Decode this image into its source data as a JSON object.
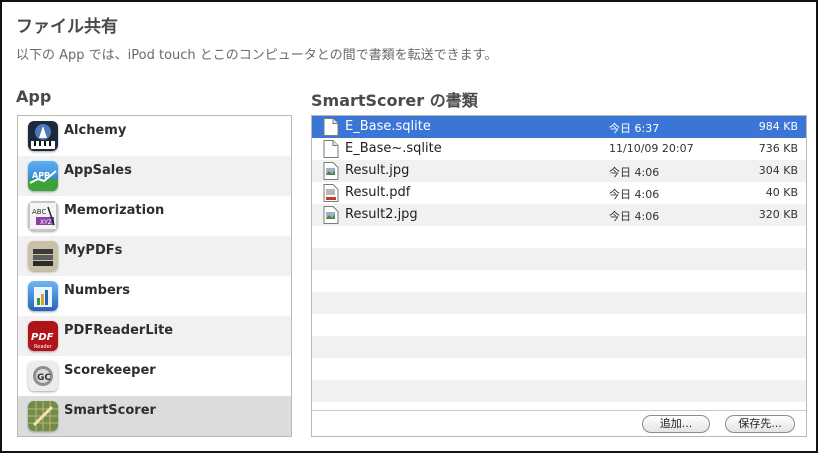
{
  "header": {
    "title": "ファイル共有",
    "subtitle": "以下の App では、iPod touch とこのコンピュータとの間で書類を転送できます。"
  },
  "apps": {
    "heading": "App",
    "items": [
      {
        "name": "Alchemy",
        "icon": "alchemy-icon"
      },
      {
        "name": "AppSales",
        "icon": "appsales-icon"
      },
      {
        "name": "Memorization",
        "icon": "memorization-icon"
      },
      {
        "name": "MyPDFs",
        "icon": "mypdfs-icon"
      },
      {
        "name": "Numbers",
        "icon": "numbers-icon"
      },
      {
        "name": "PDFReaderLite",
        "icon": "pdfreaderlite-icon"
      },
      {
        "name": "Scorekeeper",
        "icon": "scorekeeper-icon"
      },
      {
        "name": "SmartScorer",
        "icon": "smartscorer-icon"
      }
    ],
    "selected": "SmartScorer"
  },
  "documents": {
    "heading": "SmartScorer の書類",
    "files": [
      {
        "name": "E_Base.sqlite",
        "date": "今日 6:37",
        "size": "984 KB",
        "icon": "document-icon"
      },
      {
        "name": "E_Base~.sqlite",
        "date": "11/10/09 20:07",
        "size": "736 KB",
        "icon": "document-icon"
      },
      {
        "name": "Result.jpg",
        "date": "今日 4:06",
        "size": "304 KB",
        "icon": "image-file-icon"
      },
      {
        "name": "Result.pdf",
        "date": "今日 4:06",
        "size": "40 KB",
        "icon": "pdf-file-icon"
      },
      {
        "name": "Result2.jpg",
        "date": "今日 4:06",
        "size": "320 KB",
        "icon": "image-file-icon"
      }
    ],
    "selected": "E_Base.sqlite",
    "add_label": "追加...",
    "save_label": "保存先..."
  },
  "colors": {
    "selection": "#3b76d6",
    "row_alt": "#f1f1f1"
  }
}
